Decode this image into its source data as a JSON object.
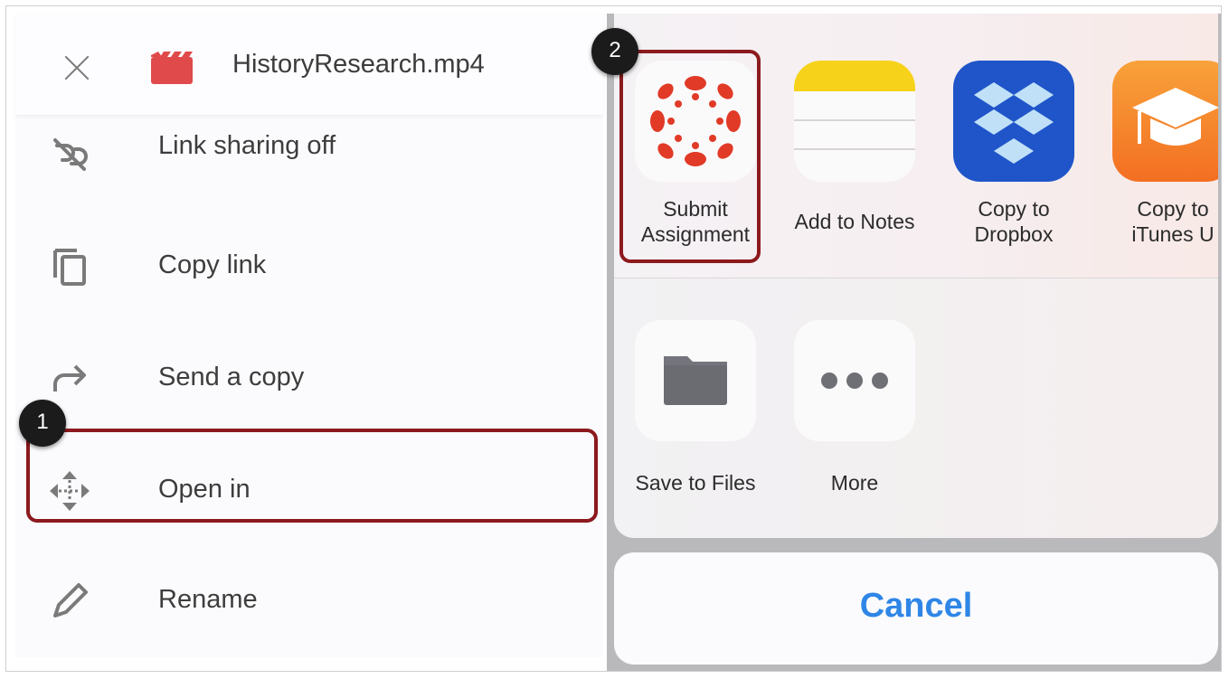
{
  "header": {
    "close_icon": "close-icon",
    "file_icon": "video-file-icon",
    "filename": "HistoryResearch.mp4"
  },
  "menu": [
    {
      "label": "Link sharing off",
      "icon": "link-off-icon"
    },
    {
      "label": "Copy link",
      "icon": "copy-icon"
    },
    {
      "label": "Send a copy",
      "icon": "share-arrow-icon"
    },
    {
      "label": "Open in",
      "icon": "move-arrows-icon"
    },
    {
      "label": "Rename",
      "icon": "pencil-icon"
    }
  ],
  "share_sheet": {
    "apps": [
      {
        "label": "Submit Assignment",
        "icon": "canvas-logo-icon"
      },
      {
        "label": "Add to Notes",
        "icon": "notes-icon"
      },
      {
        "label": "Copy to Dropbox",
        "icon": "dropbox-icon"
      },
      {
        "label": "Copy to iTunes U",
        "icon": "itunes-u-icon"
      }
    ],
    "actions": [
      {
        "label": "Save to Files",
        "icon": "folder-icon"
      },
      {
        "label": "More",
        "icon": "more-dots-icon"
      }
    ],
    "cancel_label": "Cancel"
  },
  "callouts": {
    "step1": "1",
    "step2": "2"
  },
  "colors": {
    "highlight": "#8c1a1e",
    "canvas_red": "#e13a27",
    "dropbox_blue": "#1f55c9",
    "itunes_orange": "#f4812a",
    "cancel_blue": "#2f86e6",
    "notes_yellow": "#f6d21a"
  }
}
